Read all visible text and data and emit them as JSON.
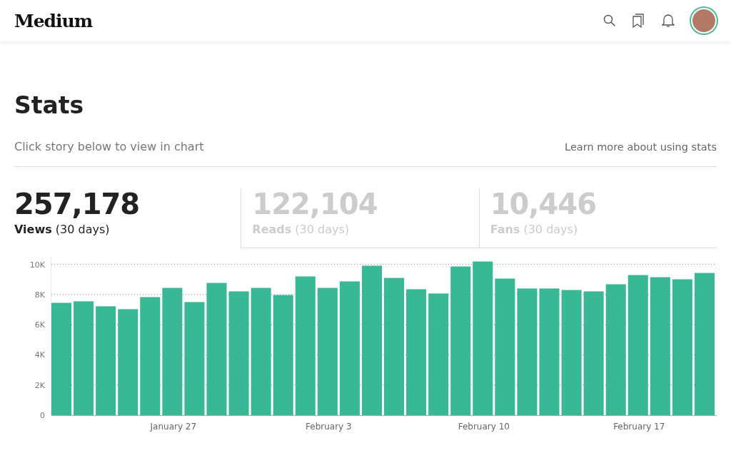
{
  "header": {
    "logo": "Medium"
  },
  "page": {
    "title": "Stats",
    "subtitle": "Click story below to view in chart",
    "help_link": "Learn more about using stats"
  },
  "metrics": [
    {
      "value": "257,178",
      "label": "Views",
      "period": "(30 days)",
      "selected": true
    },
    {
      "value": "122,104",
      "label": "Reads",
      "period": "(30 days)",
      "selected": false
    },
    {
      "value": "10,446",
      "label": "Fans",
      "period": "(30 days)",
      "selected": false
    }
  ],
  "chart": {
    "chart_data": {
      "type": "bar",
      "ylim": [
        0,
        10500
      ],
      "grid": true,
      "yticks": [
        {
          "value": 0,
          "label": "0"
        },
        {
          "value": 2000,
          "label": "2K"
        },
        {
          "value": 4000,
          "label": "4K"
        },
        {
          "value": 6000,
          "label": "6K"
        },
        {
          "value": 8000,
          "label": "8K"
        },
        {
          "value": 10000,
          "label": "10K"
        }
      ],
      "categories": [
        null,
        null,
        null,
        null,
        null,
        "January 27",
        null,
        null,
        null,
        null,
        null,
        null,
        "February 3",
        null,
        null,
        null,
        null,
        null,
        null,
        "February 10",
        null,
        null,
        null,
        null,
        null,
        null,
        "February 17",
        null,
        null,
        null
      ],
      "series": [
        {
          "color": "#38b894",
          "values": [
            7450,
            7550,
            7220,
            7030,
            7830,
            8440,
            7500,
            8770,
            8210,
            8440,
            7970,
            9200,
            8440,
            8870,
            9910,
            9100,
            8350,
            8070,
            9860,
            10190,
            9060,
            8400,
            8400,
            8300,
            8210,
            8680,
            9290,
            9150,
            9010,
            9430
          ]
        }
      ]
    }
  }
}
